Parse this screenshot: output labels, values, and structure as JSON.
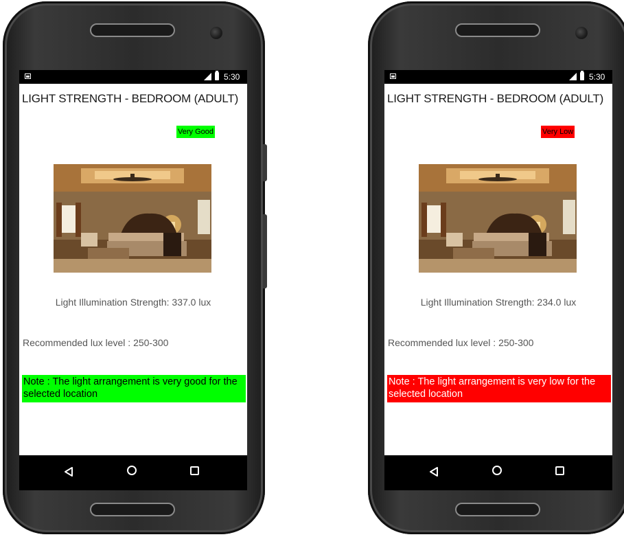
{
  "screens": [
    {
      "status_time": "5:30",
      "title": "LIGHT STRENGTH - BEDROOM (ADULT)",
      "rating_label": "Very Good",
      "rating_color": "#00ff00",
      "lux_reading": "Light Illumination Strength: 337.0 lux",
      "recommended": "Recommended lux level : 250-300",
      "note": "Note : The light arrangement is very good for the selected location",
      "note_color": "#00ff00",
      "text_color": "#000000"
    },
    {
      "status_time": "5:30",
      "title": "LIGHT STRENGTH - BEDROOM (ADULT)",
      "rating_label": "Very Low",
      "rating_color": "#ff0000",
      "lux_reading": "Light Illumination Strength: 234.0 lux",
      "recommended": "Recommended lux level : 250-300",
      "note": "Note : The light arrangement is very low for the selected location",
      "note_color": "#ff0000",
      "text_color": "#ffffff"
    }
  ],
  "icons": {
    "status_left": "image-notification-icon",
    "signal": "signal-icon",
    "battery": "battery-icon",
    "nav_back": "back-icon",
    "nav_home": "home-icon",
    "nav_recents": "recents-icon"
  }
}
